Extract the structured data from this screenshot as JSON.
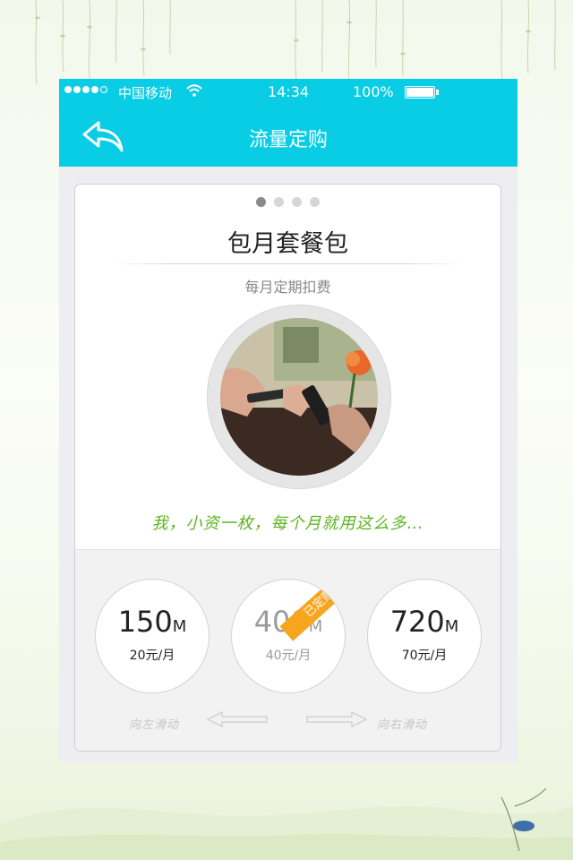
{
  "status_bar": {
    "carrier": "中国移动",
    "time": "14:34",
    "battery": "100%",
    "signal_icon": "signal-dots-icon",
    "wifi_icon": "wifi-icon"
  },
  "nav": {
    "title": "流量定购",
    "back_icon": "back-arrow-icon",
    "color": "#08cde5"
  },
  "card": {
    "pager": {
      "count": 4,
      "active_index": 0
    },
    "title": "包月套餐包",
    "subtitle": "每月定期扣费",
    "quote": "我，小资一枚，每个月就用这么多…",
    "quote_color": "#5db420"
  },
  "plans": [
    {
      "size": "150",
      "unit": "M",
      "price": "20元/月",
      "bought": false
    },
    {
      "size": "400",
      "unit": "M",
      "price": "40元/月",
      "bought": true,
      "badge": "已定购"
    },
    {
      "size": "720",
      "unit": "M",
      "price": "70元/月",
      "bought": false
    }
  ],
  "hints": {
    "swipe_left": "向左滑动",
    "swipe_right": "向右滑动"
  },
  "colors": {
    "badge": "#f7a51f",
    "accent": "#08cde5"
  }
}
